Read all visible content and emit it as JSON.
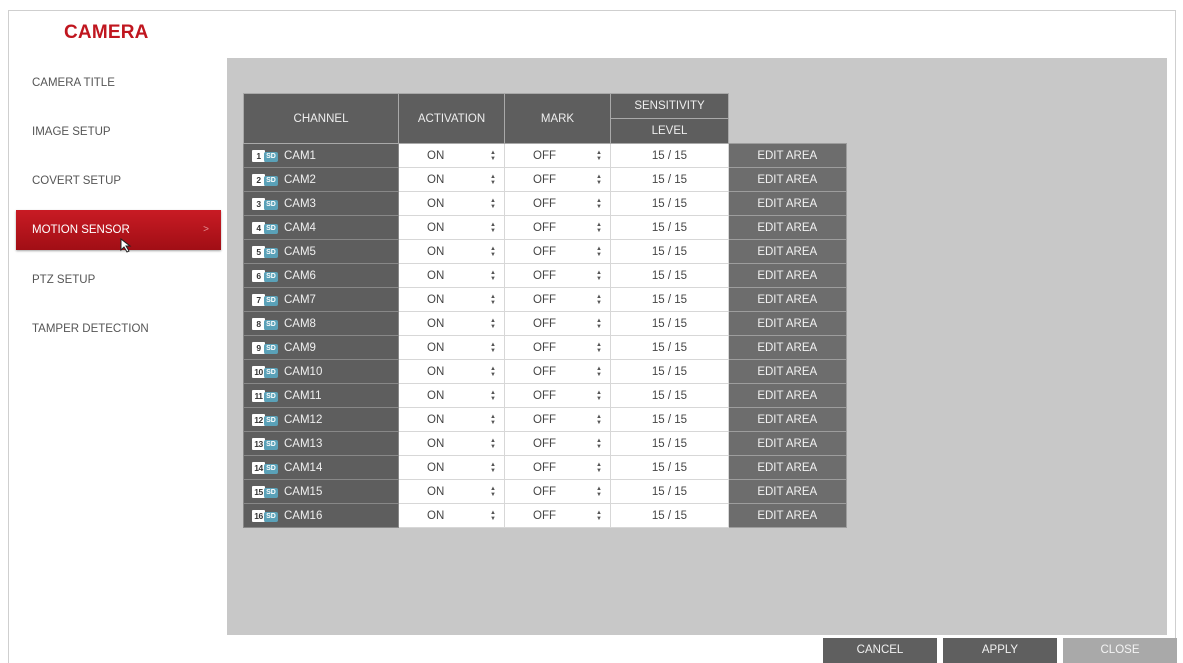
{
  "window": {
    "title": "CAMERA"
  },
  "menu": {
    "items": [
      {
        "label": "CAMERA TITLE",
        "active": false
      },
      {
        "label": "IMAGE SETUP",
        "active": false
      },
      {
        "label": "COVERT SETUP",
        "active": false
      },
      {
        "label": "MOTION SENSOR",
        "active": true
      },
      {
        "label": "PTZ SETUP",
        "active": false
      },
      {
        "label": "TAMPER DETECTION",
        "active": false
      }
    ],
    "chevron": ">"
  },
  "table": {
    "headers": {
      "channel": "CHANNEL",
      "activation": "ACTIVATION",
      "mark": "MARK",
      "sensitivity": "SENSITIVITY",
      "level": "LEVEL"
    },
    "badge": "SD",
    "rows": [
      {
        "num": "1",
        "channel": "CAM1",
        "activation": "ON",
        "mark": "OFF",
        "level": "15 / 15",
        "action": "EDIT AREA"
      },
      {
        "num": "2",
        "channel": "CAM2",
        "activation": "ON",
        "mark": "OFF",
        "level": "15 / 15",
        "action": "EDIT AREA"
      },
      {
        "num": "3",
        "channel": "CAM3",
        "activation": "ON",
        "mark": "OFF",
        "level": "15 / 15",
        "action": "EDIT AREA"
      },
      {
        "num": "4",
        "channel": "CAM4",
        "activation": "ON",
        "mark": "OFF",
        "level": "15 / 15",
        "action": "EDIT AREA"
      },
      {
        "num": "5",
        "channel": "CAM5",
        "activation": "ON",
        "mark": "OFF",
        "level": "15 / 15",
        "action": "EDIT AREA"
      },
      {
        "num": "6",
        "channel": "CAM6",
        "activation": "ON",
        "mark": "OFF",
        "level": "15 / 15",
        "action": "EDIT AREA"
      },
      {
        "num": "7",
        "channel": "CAM7",
        "activation": "ON",
        "mark": "OFF",
        "level": "15 / 15",
        "action": "EDIT AREA"
      },
      {
        "num": "8",
        "channel": "CAM8",
        "activation": "ON",
        "mark": "OFF",
        "level": "15 / 15",
        "action": "EDIT AREA"
      },
      {
        "num": "9",
        "channel": "CAM9",
        "activation": "ON",
        "mark": "OFF",
        "level": "15 / 15",
        "action": "EDIT AREA"
      },
      {
        "num": "10",
        "channel": "CAM10",
        "activation": "ON",
        "mark": "OFF",
        "level": "15 / 15",
        "action": "EDIT AREA"
      },
      {
        "num": "11",
        "channel": "CAM11",
        "activation": "ON",
        "mark": "OFF",
        "level": "15 / 15",
        "action": "EDIT AREA"
      },
      {
        "num": "12",
        "channel": "CAM12",
        "activation": "ON",
        "mark": "OFF",
        "level": "15 / 15",
        "action": "EDIT AREA"
      },
      {
        "num": "13",
        "channel": "CAM13",
        "activation": "ON",
        "mark": "OFF",
        "level": "15 / 15",
        "action": "EDIT AREA"
      },
      {
        "num": "14",
        "channel": "CAM14",
        "activation": "ON",
        "mark": "OFF",
        "level": "15 / 15",
        "action": "EDIT AREA"
      },
      {
        "num": "15",
        "channel": "CAM15",
        "activation": "ON",
        "mark": "OFF",
        "level": "15 / 15",
        "action": "EDIT AREA"
      },
      {
        "num": "16",
        "channel": "CAM16",
        "activation": "ON",
        "mark": "OFF",
        "level": "15 / 15",
        "action": "EDIT AREA"
      }
    ]
  },
  "buttons": {
    "cancel": "CANCEL",
    "apply": "APPLY",
    "close": "CLOSE"
  },
  "colors": {
    "accent": "#c0161f",
    "active_menu": "#b3121b",
    "panel": "#c8c8c8",
    "header": "#5e5e5e",
    "badge": "#5aa1b8"
  },
  "icons": {
    "spinner": "up-down-arrows-icon",
    "cursor": "mouse-pointer-icon",
    "camera_badge": "camera-sd-icon"
  }
}
